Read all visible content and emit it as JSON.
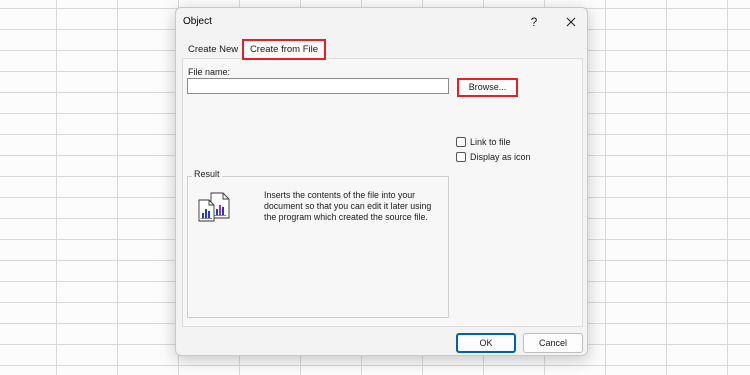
{
  "dialog": {
    "title": "Object",
    "help_label": "?",
    "close_icon": "close-icon"
  },
  "tabs": [
    {
      "label": "Create New",
      "active": false
    },
    {
      "label": "Create from File",
      "active": true
    }
  ],
  "file_name": {
    "label": "File name:",
    "value": ""
  },
  "browse_label": "Browse...",
  "options": {
    "link_to_file": {
      "label": "Link to file",
      "checked": false
    },
    "display_as_icon": {
      "label": "Display as icon",
      "checked": false
    }
  },
  "result": {
    "legend": "Result",
    "icon": "file-link-icon",
    "text": "Inserts the contents of the file into your document so that you can edit it later using the program which created the source file."
  },
  "footer": {
    "ok_label": "OK",
    "cancel_label": "Cancel"
  },
  "colors": {
    "highlight": "#e2202a",
    "default_button_border": "#005fb8"
  }
}
